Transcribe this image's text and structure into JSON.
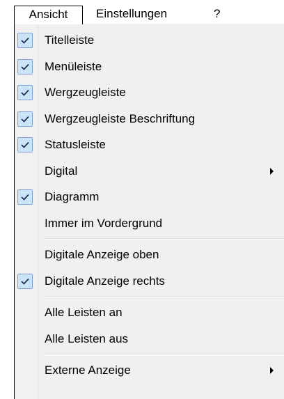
{
  "menubar": {
    "items": [
      {
        "label": "Ansicht",
        "open": true
      },
      {
        "label": "Einstellungen",
        "open": false
      },
      {
        "label": "?",
        "open": false
      }
    ]
  },
  "dropdown": {
    "items": [
      {
        "label": "Titelleiste",
        "checked": true,
        "submenu": false
      },
      {
        "label": "Menüleiste",
        "checked": true,
        "submenu": false
      },
      {
        "label": "Wergzeugleiste",
        "checked": true,
        "submenu": false
      },
      {
        "label": "Wergzeugleiste Beschriftung",
        "checked": true,
        "submenu": false
      },
      {
        "label": "Statusleiste",
        "checked": true,
        "submenu": false
      },
      {
        "label": "Digital",
        "checked": false,
        "submenu": true
      },
      {
        "label": "Diagramm",
        "checked": true,
        "submenu": false
      },
      {
        "label": "Immer im Vordergrund",
        "checked": false,
        "submenu": false
      },
      {
        "separator": true
      },
      {
        "label": "Digitale Anzeige oben",
        "checked": false,
        "submenu": false
      },
      {
        "label": "Digitale Anzeige rechts",
        "checked": true,
        "submenu": false
      },
      {
        "separator": true
      },
      {
        "label": "Alle Leisten an",
        "checked": false,
        "submenu": false
      },
      {
        "label": "Alle Leisten aus",
        "checked": false,
        "submenu": false
      },
      {
        "separator": true
      },
      {
        "label": "Externe Anzeige",
        "checked": false,
        "submenu": true
      }
    ]
  },
  "colors": {
    "check_bg": "#cde4f7",
    "check_border": "#7da2ce",
    "menu_bg": "#f0f0f0"
  }
}
